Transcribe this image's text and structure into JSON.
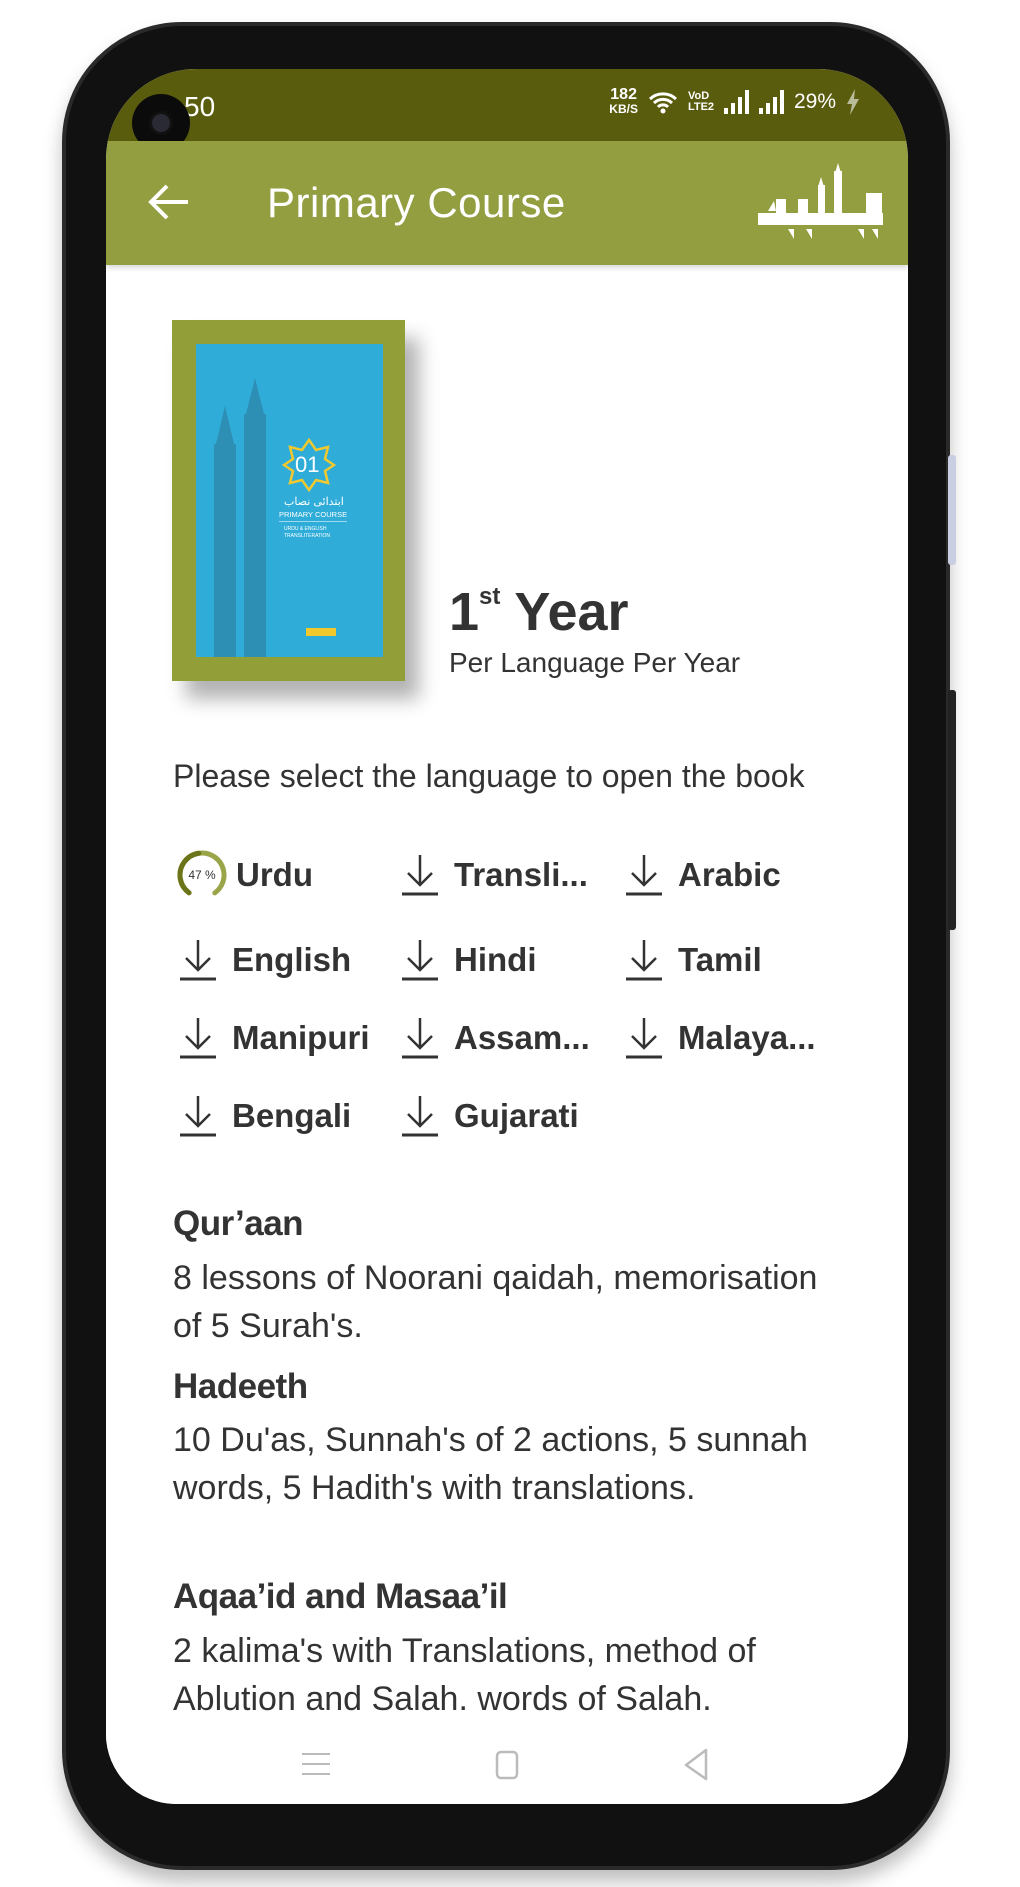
{
  "status_bar": {
    "time": "50",
    "net_speed_value": "182",
    "net_speed_unit": "KB/S",
    "volte": "VoD LTE2",
    "battery": "29%"
  },
  "app_bar": {
    "title": "Primary Course",
    "logo_text": "دینیات"
  },
  "book": {
    "cover_number": "01",
    "cover_urdu": "ابتدائی نصاب",
    "cover_title": "PRIMARY COURSE",
    "cover_subtitle": "URDU & ENGLISH TRANSLITERATION",
    "year_number": "1",
    "year_suffix": "st",
    "year_word": "Year",
    "price_note": "Per Language Per Year"
  },
  "prompt": "Please select the language to open the book",
  "languages": [
    {
      "label": "Urdu",
      "state": "downloading",
      "progress": 47,
      "progress_label": "47 %"
    },
    {
      "label": "Transli...",
      "state": "download"
    },
    {
      "label": "Arabic",
      "state": "download"
    },
    {
      "label": "English",
      "state": "download"
    },
    {
      "label": "Hindi",
      "state": "download"
    },
    {
      "label": "Tamil",
      "state": "download"
    },
    {
      "label": "Manipuri",
      "state": "download"
    },
    {
      "label": "Assam...",
      "state": "download"
    },
    {
      "label": "Malaya...",
      "state": "download"
    },
    {
      "label": "Bengali",
      "state": "download"
    },
    {
      "label": "Gujarati",
      "state": "download"
    }
  ],
  "sections": [
    {
      "heading": "Qur’aan",
      "body": "8 lessons of Noorani qaidah, memorisation of 5 Surah's."
    },
    {
      "heading": "Hadeeth",
      "body": "10 Du'as, Sunnah's of 2 actions, 5 sunnah words, 5 Hadith's with translations."
    },
    {
      "heading": "Aqaa’id and Masaa’il",
      "body": "2 kalima's with Translations, method of Ablution and Salah. words of Salah."
    }
  ],
  "colors": {
    "status_bar": "#5a5c0d",
    "app_bar": "#929e40",
    "cover_blue": "#2fadd8",
    "progress": "#6b7418"
  }
}
